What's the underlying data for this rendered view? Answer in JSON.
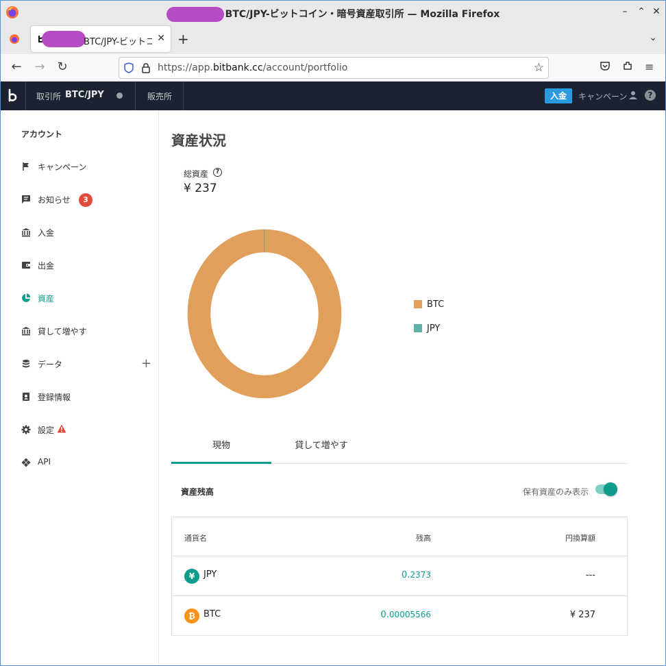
{
  "window": {
    "title": "BTC/JPY-ビットコイン・暗号資産取引所 — Mozilla Firefox",
    "controls": [
      "–",
      "⌃",
      "✕"
    ]
  },
  "browser": {
    "tab_title": "BTC/JPY-ビットコイン",
    "new_tab": "+",
    "url_prefix": "https://app.",
    "url_domain": "bitbank.cc",
    "url_path": "/account/portfolio"
  },
  "app_header": {
    "exchange_label": "取引所",
    "pair": "BTC/JPY",
    "sales_label": "販売所",
    "deposit_button": "入金",
    "campaign_label": "キャンペーン",
    "help": "?"
  },
  "sidebar": {
    "heading": "アカウント",
    "items": [
      {
        "label": "キャンペーン",
        "icon": "flag-icon"
      },
      {
        "label": "お知らせ",
        "icon": "message-icon",
        "badge": "3"
      },
      {
        "label": "入金",
        "icon": "bank-icon"
      },
      {
        "label": "出金",
        "icon": "wallet-icon"
      },
      {
        "label": "資産",
        "icon": "pie-chart-icon",
        "active": true
      },
      {
        "label": "貸して増やす",
        "icon": "bank-icon"
      },
      {
        "label": "データ",
        "icon": "database-icon",
        "expand": "+"
      },
      {
        "label": "登録情報",
        "icon": "id-badge-icon"
      },
      {
        "label": "設定",
        "icon": "gear-icon",
        "warning": true
      },
      {
        "label": "API",
        "icon": "api-icon"
      }
    ]
  },
  "main": {
    "title": "資産状況",
    "total_label": "総資産",
    "total_value": "¥ 237",
    "tabs": [
      "現物",
      "貸して増やす"
    ],
    "section_title": "資産残高",
    "holdings_only_label": "保有資産のみ表示",
    "holdings_only_enabled": true,
    "table": {
      "headers": [
        "通貨名",
        "残高",
        "円換算額"
      ],
      "rows": [
        {
          "currency": "JPY",
          "icon_glyph": "¥",
          "balance_int": "0.",
          "balance_frac": "2373",
          "jpy_value": "---",
          "color": "#0e9d8c"
        },
        {
          "currency": "BTC",
          "icon_glyph": "₿",
          "balance_int": "0.",
          "balance_frac": "00005566",
          "jpy_value": "¥ 237",
          "color": "#f7931a"
        }
      ]
    }
  },
  "chart_data": {
    "type": "pie",
    "style": "donut",
    "categories": [
      "BTC",
      "JPY"
    ],
    "values": [
      237,
      0.2373
    ],
    "colors": [
      "#e0a05c",
      "#5db3a8"
    ],
    "legend": "right"
  },
  "colors": {
    "accent": "#0e9d8c",
    "header_bg": "#1d2230",
    "deposit_button": "#2b9be0",
    "badge": "#e04b3c"
  }
}
